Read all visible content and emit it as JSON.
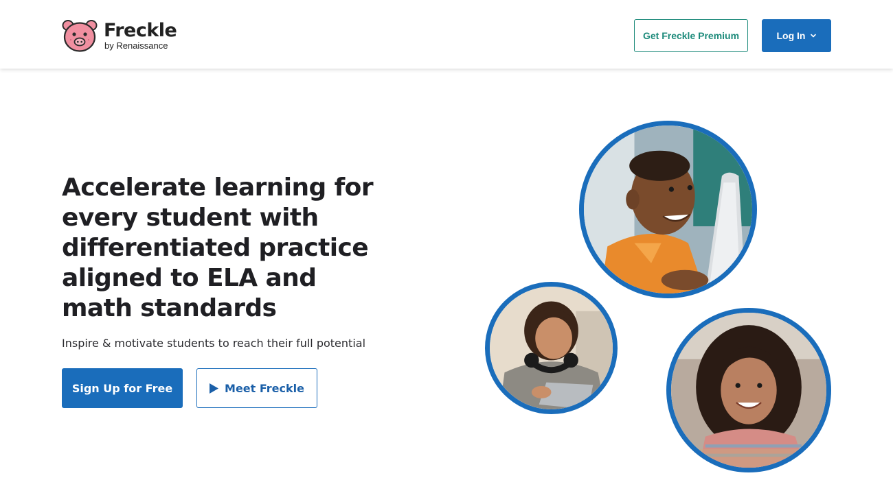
{
  "header": {
    "logo": {
      "name": "Freckle",
      "byline": "by Renaissance",
      "icon": "pig-logo-icon"
    },
    "premium_label": "Get Freckle Premium",
    "login_label": "Log In",
    "login_icon": "chevron-down-icon"
  },
  "hero": {
    "headline": "Accelerate learning for every student with differentiated practice aligned to ELA and math standards",
    "subhead": "Inspire & motivate students to reach their full potential",
    "signup_label": "Sign Up for Free",
    "meet_label": "Meet Freckle",
    "meet_icon": "play-icon"
  },
  "photos": [
    {
      "name": "photo-boy-laptop"
    },
    {
      "name": "photo-teen-tablet"
    },
    {
      "name": "photo-girl-smiling"
    }
  ],
  "colors": {
    "brand_blue": "#1a6dbb",
    "premium_green": "#1c8a7a",
    "text_dark": "#1f1f23",
    "pig_pink": "#f08fa0"
  }
}
